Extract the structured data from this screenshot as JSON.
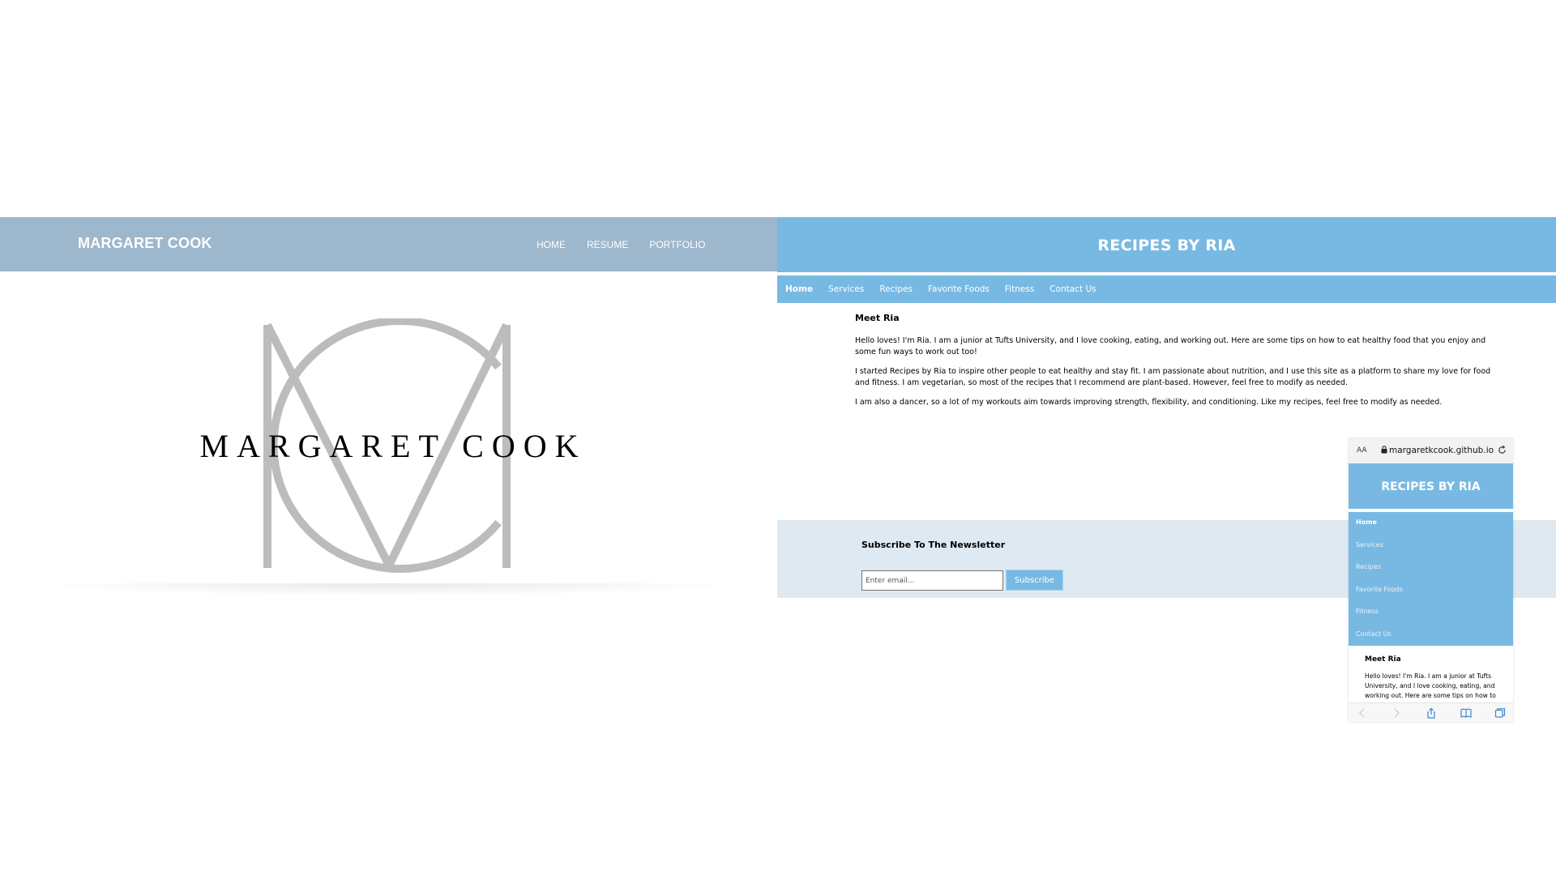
{
  "margaret_site": {
    "brand": "MARGARET COOK",
    "nav": [
      "HOME",
      "RESUME",
      "PORTFOLIO"
    ],
    "logo_text": "MARGARET COOK",
    "colors": {
      "header_bg": "#9db7cc",
      "logo_monogram": "#bcbcbc"
    }
  },
  "ria_site": {
    "title": "RECIPES BY RIA",
    "nav": [
      "Home",
      "Services",
      "Recipes",
      "Favorite Foods",
      "Fitness",
      "Contact Us"
    ],
    "active_nav": "Home",
    "heading": "Meet Ria",
    "paragraphs": [
      "Hello loves! I'm Ria. I am a junior at Tufts University, and I love cooking, eating, and working out. Here are some tips on how to eat healthy food that you enjoy and some fun ways to work out too!",
      "I started Recipes by Ria to inspire other people to eat healthy and stay fit. I am passionate about nutrition, and I use this site as a platform to share my love for food and fitness. I am vegetarian, so most of the recipes that I recommend are plant-based. However, feel free to modify as needed.",
      "I am also a dancer, so a lot of my workouts aim towards improving strength, flexibility, and conditioning. Like my recipes, feel free to modify as needed."
    ],
    "newsletter": {
      "heading": "Subscribe To The Newsletter",
      "email_placeholder": "Enter email...",
      "button_label": "Subscribe"
    },
    "colors": {
      "primary": "#78b9e3",
      "footer_bg": "#dfe9f1"
    }
  },
  "phone": {
    "text_size_label": "AA",
    "url": "margaretkcook.github.io",
    "title": "RECIPES BY RIA",
    "nav": [
      "Home",
      "Services",
      "Recipes",
      "Favorite Foods",
      "Fitness",
      "Contact Us"
    ],
    "heading": "Meet Ria",
    "paragraph": "Hello loves! I'm Ria. I am a junior at Tufts University, and I love cooking, eating, and working out. Here are some tips on how to",
    "icons": [
      "lock-icon",
      "reload-icon",
      "back-icon",
      "forward-icon",
      "share-icon",
      "bookmarks-icon",
      "tabs-icon"
    ]
  }
}
